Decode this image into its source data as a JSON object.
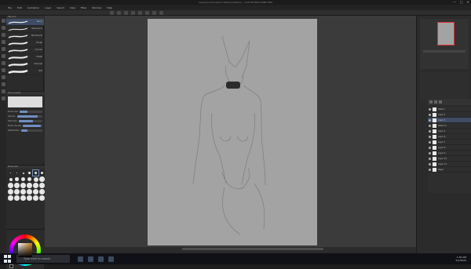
{
  "window": {
    "title": "Layer/[Lorem-ipsum Atelier] (Sketch) - CLIP STUDIO PAINT PRO",
    "controls": [
      "—",
      "□",
      "✕"
    ]
  },
  "menu": [
    "File",
    "Edit",
    "Animation",
    "Layer",
    "Select",
    "View",
    "Filter",
    "Window",
    "Help"
  ],
  "subtool": {
    "header": "Sub tool",
    "brushes": [
      "Pencil",
      "Real pencil",
      "Mechanical",
      "Rough",
      "Colored",
      "Pastel",
      "Charcoal",
      "Soft"
    ]
  },
  "tool_property": {
    "header": "Tool property",
    "rows": [
      {
        "label": "Brush size",
        "value": 0.35
      },
      {
        "label": "Opacity",
        "value": 0.8
      },
      {
        "label": "Hardness",
        "value": 0.6
      },
      {
        "label": "Brush density",
        "value": 0.9
      },
      {
        "label": "Stabilization",
        "value": 0.3
      }
    ]
  },
  "brush_size": {
    "header": "Brush Size"
  },
  "layers": {
    "items": [
      "Sketch",
      "Layer 2",
      "Layer 3",
      "Sketch 2",
      "Layer 5",
      "Layer 6",
      "Layer 7",
      "Layer 8",
      "Layer 9",
      "Layer 10",
      "Layer 11",
      "Paper"
    ],
    "selected_index": 2
  },
  "taskbar": {
    "search_placeholder": "Type here to search",
    "time": "1:30 AM",
    "date": "5/1/2020"
  },
  "colors": {
    "accent": "#3f4c66",
    "paper": "#a3a3a3",
    "workspace": "#3b3b3b"
  }
}
